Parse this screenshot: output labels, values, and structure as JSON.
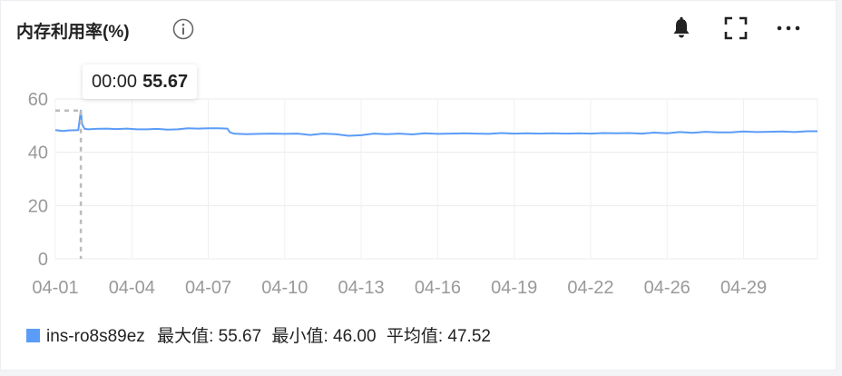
{
  "panel": {
    "title": "内存利用率(%)",
    "info_icon": "info-circle-icon",
    "actions": [
      "bell-icon",
      "fullscreen-icon",
      "more-icon"
    ]
  },
  "tooltip": {
    "time": "00:00",
    "value": "55.67"
  },
  "legend": {
    "series_name": "ins-ro8s89ez",
    "max_label": "最大值:",
    "max_value": "55.67",
    "min_label": "最小值:",
    "min_value": "46.00",
    "avg_label": "平均值:",
    "avg_value": "47.52",
    "color": "#5b9cf8"
  },
  "chart_data": {
    "type": "line",
    "title": "内存利用率(%)",
    "xlabel": "",
    "ylabel": "",
    "ylim": [
      0,
      60
    ],
    "yticks": [
      0,
      20,
      40,
      60
    ],
    "xlim": [
      0,
      29.9
    ],
    "xticks": [
      {
        "x": 0,
        "label": "04-01"
      },
      {
        "x": 3,
        "label": "04-04"
      },
      {
        "x": 6,
        "label": "04-07"
      },
      {
        "x": 9,
        "label": "04-10"
      },
      {
        "x": 12,
        "label": "04-13"
      },
      {
        "x": 15,
        "label": "04-16"
      },
      {
        "x": 18,
        "label": "04-19"
      },
      {
        "x": 21,
        "label": "04-22"
      },
      {
        "x": 24,
        "label": "04-26"
      },
      {
        "x": 27,
        "label": "04-29"
      }
    ],
    "grid": true,
    "legend_position": "bottom-left",
    "series": [
      {
        "name": "ins-ro8s89ez",
        "color": "#5b9cf8",
        "x": [
          0,
          0.3,
          0.5,
          0.9,
          1.0,
          1.05,
          1.15,
          1.3,
          1.6,
          2.0,
          2.4,
          2.8,
          3.2,
          3.6,
          4.0,
          4.4,
          4.8,
          5.2,
          5.6,
          6.0,
          6.4,
          6.75,
          6.85,
          7.0,
          7.5,
          8.0,
          8.5,
          9.0,
          9.5,
          10.0,
          10.5,
          11.0,
          11.5,
          12.0,
          12.5,
          13.0,
          13.5,
          14.0,
          14.5,
          15.0,
          15.5,
          16.0,
          16.5,
          17.0,
          17.5,
          18.0,
          18.5,
          19.0,
          19.5,
          20.0,
          20.5,
          21.0,
          21.5,
          22.0,
          22.5,
          23.0,
          23.5,
          24.0,
          24.5,
          25.0,
          25.5,
          26.0,
          26.5,
          27.0,
          27.5,
          28.0,
          28.5,
          29.0,
          29.5,
          29.9
        ],
        "y": [
          48.3,
          48.0,
          48.2,
          48.3,
          55.67,
          50.5,
          48.8,
          48.6,
          48.8,
          48.9,
          48.7,
          48.9,
          48.6,
          48.6,
          48.8,
          48.5,
          48.6,
          49.0,
          48.9,
          49.0,
          49.0,
          48.9,
          47.5,
          47.0,
          46.8,
          46.9,
          47.0,
          46.9,
          47.0,
          46.5,
          47.0,
          46.8,
          46.2,
          46.4,
          47.0,
          46.8,
          47.0,
          46.7,
          47.1,
          46.9,
          47.0,
          47.1,
          47.0,
          46.9,
          47.2,
          47.0,
          47.1,
          47.0,
          47.1,
          47.0,
          47.1,
          47.0,
          47.2,
          47.1,
          47.2,
          47.0,
          47.4,
          47.1,
          47.6,
          47.3,
          47.7,
          47.5,
          47.5,
          47.8,
          47.6,
          47.7,
          47.8,
          47.6,
          47.9,
          47.9
        ]
      }
    ],
    "hover": {
      "x": 1.0,
      "y": 55.67
    }
  }
}
